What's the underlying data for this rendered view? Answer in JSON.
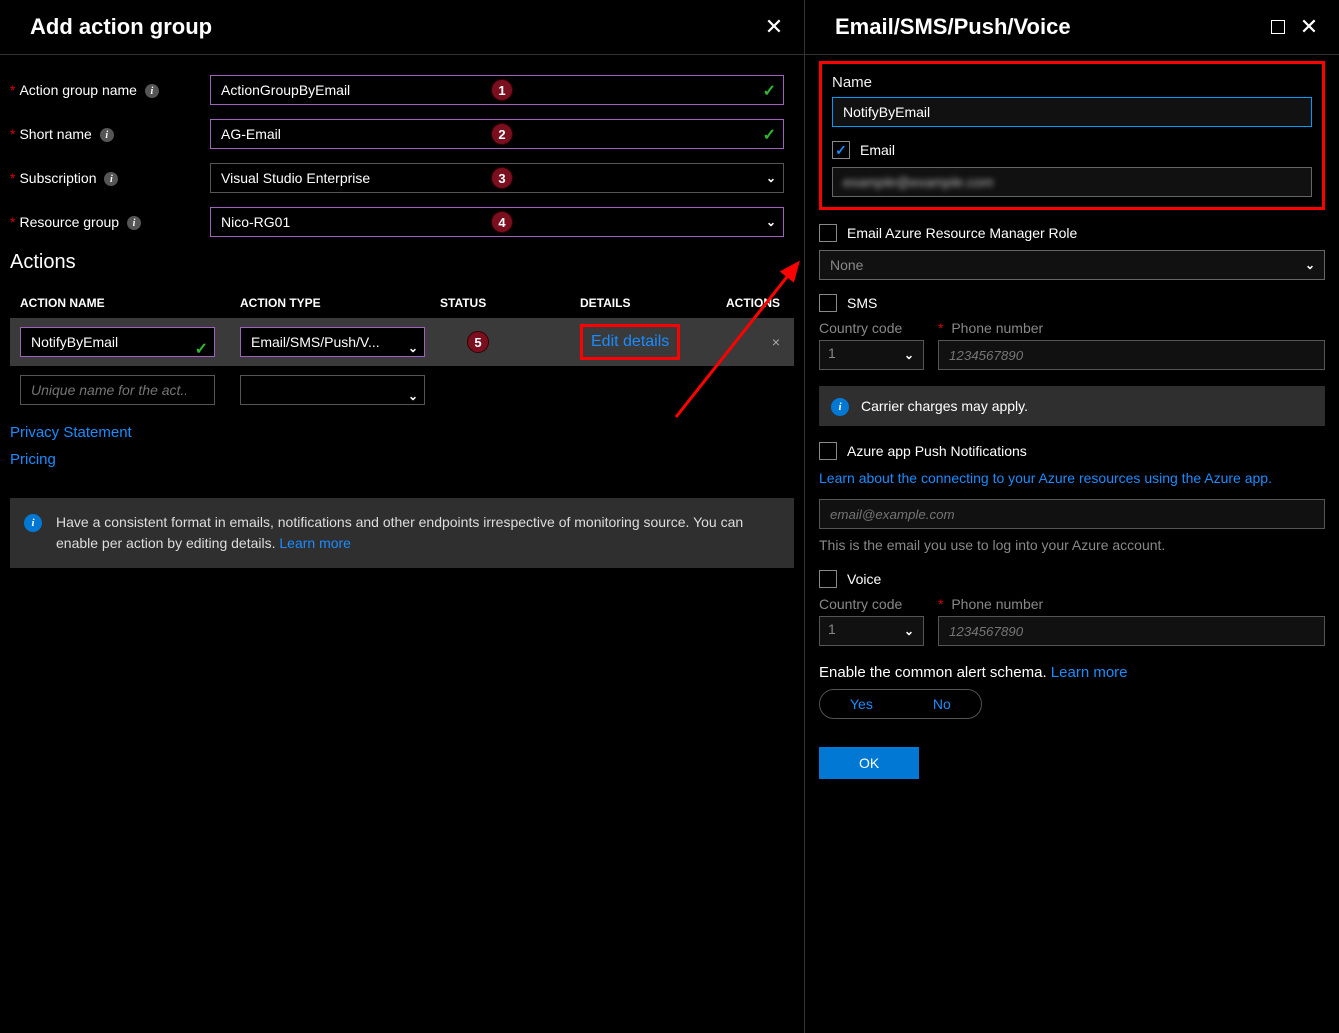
{
  "left": {
    "title": "Add action group",
    "fields": {
      "action_group_name": {
        "label": "Action group name",
        "value": "ActionGroupByEmail",
        "badge": "1"
      },
      "short_name": {
        "label": "Short name",
        "value": "AG-Email",
        "badge": "2"
      },
      "subscription": {
        "label": "Subscription",
        "value": "Visual Studio Enterprise",
        "badge": "3"
      },
      "resource_group": {
        "label": "Resource group",
        "value": "Nico-RG01",
        "badge": "4"
      }
    },
    "actions_section": "Actions",
    "table": {
      "headers": {
        "name": "ACTION NAME",
        "type": "ACTION TYPE",
        "status": "STATUS",
        "details": "DETAILS",
        "actions": "ACTIONS"
      },
      "row": {
        "name": "NotifyByEmail",
        "type": "Email/SMS/Push/V...",
        "badge": "5",
        "details_link": "Edit details",
        "remove": "×"
      },
      "empty_placeholder": "Unique name for the act..."
    },
    "links": {
      "privacy": "Privacy Statement",
      "pricing": "Pricing"
    },
    "info": {
      "text": "Have a consistent format in emails, notifications and other endpoints irrespective of monitoring source. You can enable per action by editing details. ",
      "learn_more": "Learn more"
    }
  },
  "right": {
    "title": "Email/SMS/Push/Voice",
    "name_label": "Name",
    "name_value": "NotifyByEmail",
    "email": {
      "label": "Email",
      "checked": true,
      "value_blurred": "example@example.com"
    },
    "arm_role": {
      "label": "Email Azure Resource Manager Role",
      "value": "None"
    },
    "sms": {
      "label": "SMS",
      "country_code_label": "Country code",
      "country_code": "1",
      "phone_label": "Phone number",
      "phone_placeholder": "1234567890"
    },
    "carrier_note": "Carrier charges may apply.",
    "push": {
      "label": "Azure app Push Notifications",
      "link": "Learn about the connecting to your Azure resources using the Azure app.",
      "placeholder": "email@example.com",
      "help": "This is the email you use to log into your Azure account."
    },
    "voice": {
      "label": "Voice",
      "country_code_label": "Country code",
      "country_code": "1",
      "phone_label": "Phone number",
      "phone_placeholder": "1234567890"
    },
    "schema": {
      "text": "Enable the common alert schema. ",
      "learn_more": "Learn more",
      "yes": "Yes",
      "no": "No"
    },
    "ok": "OK"
  }
}
